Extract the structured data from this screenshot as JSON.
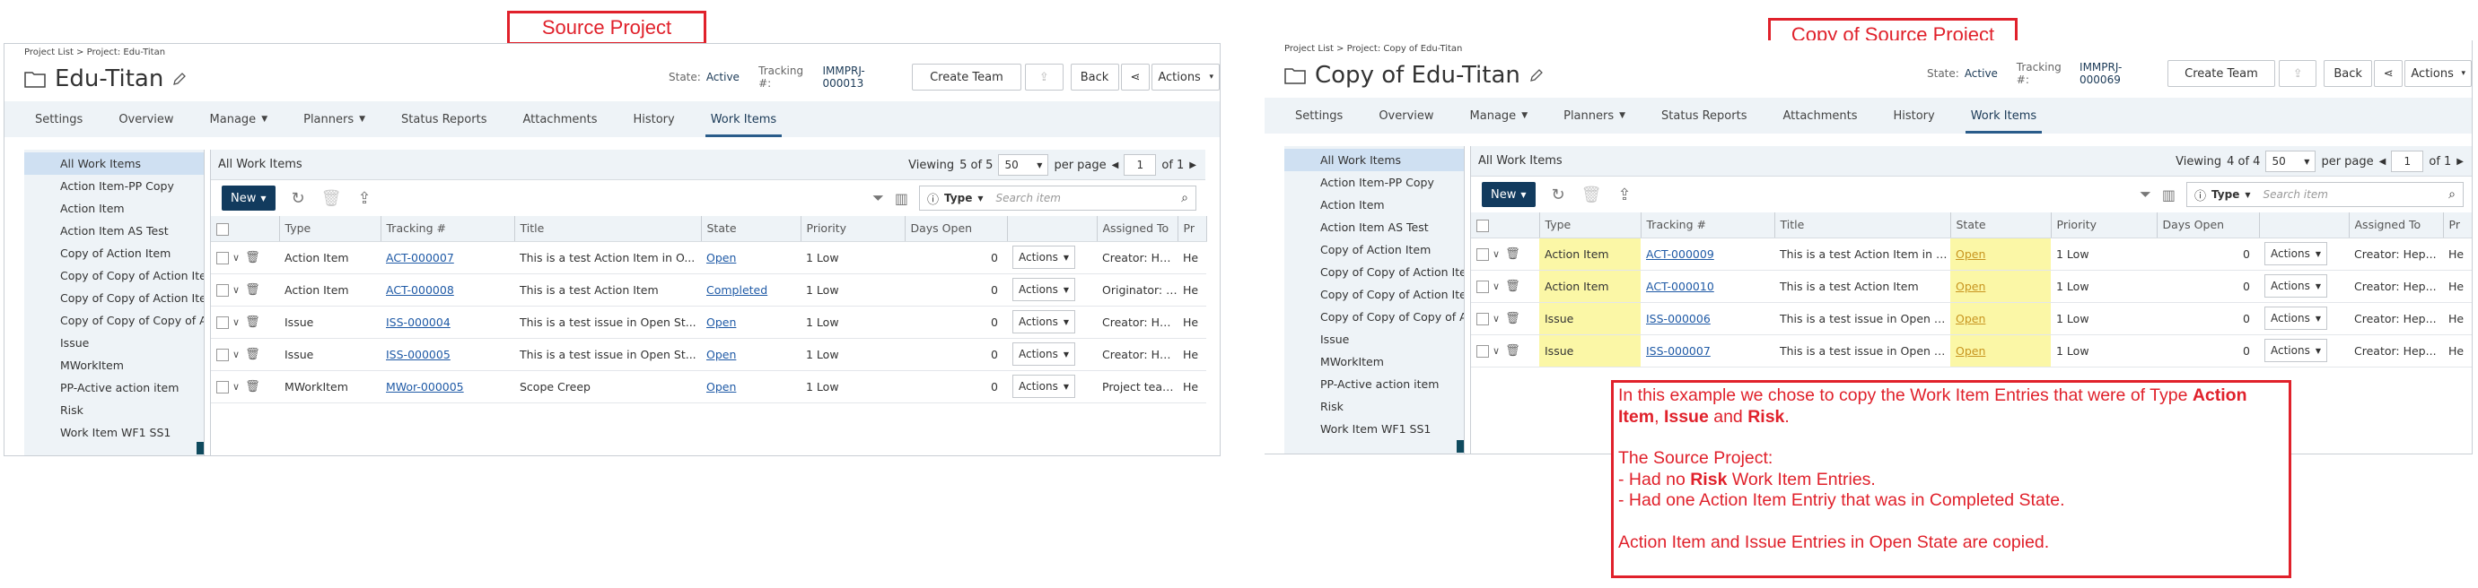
{
  "callouts": {
    "source": "Source Project",
    "copy": "Copy of Source Project"
  },
  "left": {
    "breadcrumb": "Project List > Project: Edu-Titan",
    "title": "Edu-Titan",
    "state_label": "State:",
    "state_value": "Active",
    "tracking_label": "Tracking #:",
    "tracking_value": "IMMPRJ-000013",
    "create_team": "Create Team",
    "back": "Back",
    "actions": "Actions",
    "tabs": [
      "Settings",
      "Overview",
      "Manage",
      "Planners",
      "Status Reports",
      "Attachments",
      "History",
      "Work Items"
    ],
    "sidebar": [
      "All Work Items",
      "Action Item-PP Copy",
      "Action Item",
      "Action Item AS Test",
      "Copy of Action Item",
      "Copy of Copy of Action Item",
      "Copy of Copy of Action Item",
      "Copy of Copy of Copy of Action",
      "Issue",
      "MWorkItem",
      "PP-Active action item",
      "Risk",
      "Work Item WF1 SS1"
    ],
    "main_title": "All Work Items",
    "viewing": "Viewing",
    "viewing_count": "5 of 5",
    "page_size": "50",
    "per_page": "per page",
    "page_num": "1",
    "of_pages": "of 1",
    "new_label": "New",
    "type_label": "Type",
    "search_placeholder": "Search item",
    "columns": [
      "",
      "Type",
      "Tracking #",
      "Title",
      "State",
      "Priority",
      "Days Open",
      "",
      "Assigned To",
      "Pr"
    ],
    "rows": [
      {
        "type": "Action Item",
        "tracking": "ACT-000007",
        "title": "This is a test Action Item in O...",
        "state": "Open",
        "priority": "1 Low",
        "days": "0",
        "actions": "Actions",
        "assigned": "Creator: Hep...",
        "pr": "He"
      },
      {
        "type": "Action Item",
        "tracking": "ACT-000008",
        "title": "This is a test Action Item",
        "state": "Completed",
        "priority": "1 Low",
        "days": "0",
        "actions": "Actions",
        "assigned": "Originator: H...",
        "pr": "He"
      },
      {
        "type": "Issue",
        "tracking": "ISS-000004",
        "title": "This is a test issue in Open St...",
        "state": "Open",
        "priority": "1 Low",
        "days": "0",
        "actions": "Actions",
        "assigned": "Creator: Hep...",
        "pr": "He"
      },
      {
        "type": "Issue",
        "tracking": "ISS-000005",
        "title": "This is a test issue in Open St...",
        "state": "Open",
        "priority": "1 Low",
        "days": "0",
        "actions": "Actions",
        "assigned": "Creator: Hep...",
        "pr": "He"
      },
      {
        "type": "MWorkItem",
        "tracking": "MWor-000005",
        "title": "Scope Creep",
        "state": "Open",
        "priority": "1 Low",
        "days": "0",
        "actions": "Actions",
        "assigned": "Project team...",
        "pr": "He"
      }
    ]
  },
  "right": {
    "breadcrumb": "Project List > Project: Copy of Edu-Titan",
    "title": "Copy of Edu-Titan",
    "state_label": "State:",
    "state_value": "Active",
    "tracking_label": "Tracking #:",
    "tracking_value": "IMMPRJ-000069",
    "create_team": "Create Team",
    "back": "Back",
    "actions": "Actions",
    "tabs": [
      "Settings",
      "Overview",
      "Manage",
      "Planners",
      "Status Reports",
      "Attachments",
      "History",
      "Work Items"
    ],
    "sidebar": [
      "All Work Items",
      "Action Item-PP Copy",
      "Action Item",
      "Action Item AS Test",
      "Copy of Action Item",
      "Copy of Copy of Action Item",
      "Copy of Copy of Action Item",
      "Copy of Copy of Copy of Action",
      "Issue",
      "MWorkItem",
      "PP-Active action item",
      "Risk",
      "Work Item WF1 SS1"
    ],
    "main_title": "All Work Items",
    "viewing": "Viewing",
    "viewing_count": "4 of 4",
    "page_size": "50",
    "per_page": "per page",
    "page_num": "1",
    "of_pages": "of 1",
    "new_label": "New",
    "type_label": "Type",
    "search_placeholder": "Search item",
    "columns": [
      "",
      "Type",
      "Tracking #",
      "Title",
      "State",
      "Priority",
      "Days Open",
      "",
      "Assigned To",
      "Pr"
    ],
    "rows": [
      {
        "type": "Action Item",
        "tracking": "ACT-000009",
        "title": "This is a test Action Item in Op",
        "state": "Open",
        "priority": "1 Low",
        "days": "0",
        "actions": "Actions",
        "assigned": "Creator: Hep...",
        "pr": "He"
      },
      {
        "type": "Action Item",
        "tracking": "ACT-000010",
        "title": "This is a test Action Item",
        "state": "Open",
        "priority": "1 Low",
        "days": "0",
        "actions": "Actions",
        "assigned": "Creator: Hep...",
        "pr": "He"
      },
      {
        "type": "Issue",
        "tracking": "ISS-000006",
        "title": "This is a test issue in Open Sta",
        "state": "Open",
        "priority": "1 Low",
        "days": "0",
        "actions": "Actions",
        "assigned": "Creator: Hep...",
        "pr": "He"
      },
      {
        "type": "Issue",
        "tracking": "ISS-000007",
        "title": "This is a test issue in Open Sta",
        "state": "Open",
        "priority": "1 Low",
        "days": "0",
        "actions": "Actions",
        "assigned": "Creator: Hep...",
        "pr": "He"
      }
    ]
  },
  "note": {
    "l1a": "In this example we chose to copy the Work Item Entries that were of Type ",
    "l1b": "Action Item",
    "l1c": ", ",
    "l1d": "Issue",
    "l1e": " and ",
    "l1f": "Risk",
    "l1g": ".",
    "l2": "The Source Project:",
    "l3a": "- Had no ",
    "l3b": "Risk",
    "l3c": " Work Item Entries.",
    "l4": "- Had one Action Item Entriy that was in Completed State.",
    "l5": "Action Item and Issue Entries in Open State are copied."
  },
  "colors": {
    "callout_red": "#e0212b",
    "highlight_yellow": "#fbf7a6",
    "link_blue": "#1f5aa6",
    "new_button": "#123b5e"
  }
}
